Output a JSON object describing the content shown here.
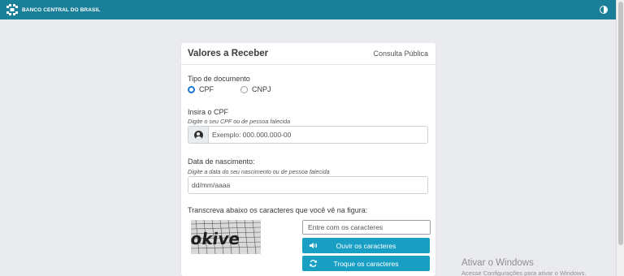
{
  "header": {
    "brand_text": "BANCO CENTRAL DO BRASIL",
    "contrast_icon": "contrast-icon",
    "background_color": "#1a7f99"
  },
  "card": {
    "title": "Valores a Receber",
    "link": "Consulta Pública"
  },
  "form": {
    "document_type": {
      "label": "Tipo de documento",
      "options": [
        "CPF",
        "CNPJ"
      ],
      "selected": "CPF"
    },
    "cpf": {
      "label": "Insira o CPF",
      "hint": "Digite o seu CPF ou de pessoa falecida",
      "placeholder": "Exemplo: 000.000.000-00",
      "icon": "user-icon"
    },
    "birth_date": {
      "label": "Data de nascimento:",
      "hint": "Digite a data do seu nascimento ou de pessoa falecida",
      "placeholder": "dd/mm/aaaa"
    },
    "captcha": {
      "label": "Transcreva abaixo os caracteres que você vê na figura:",
      "image_text": "okive",
      "input_placeholder": "Entre com os caracteres",
      "listen_button": "Ouvir os caracteres",
      "listen_icon": "speaker-icon",
      "refresh_button": "Troque os caracteres",
      "refresh_icon": "refresh-icon",
      "button_color": "#1a9fc4"
    }
  },
  "watermark": {
    "title": "Ativar o Windows",
    "subtitle": "Acesse Configurações para ativar o Windows."
  }
}
